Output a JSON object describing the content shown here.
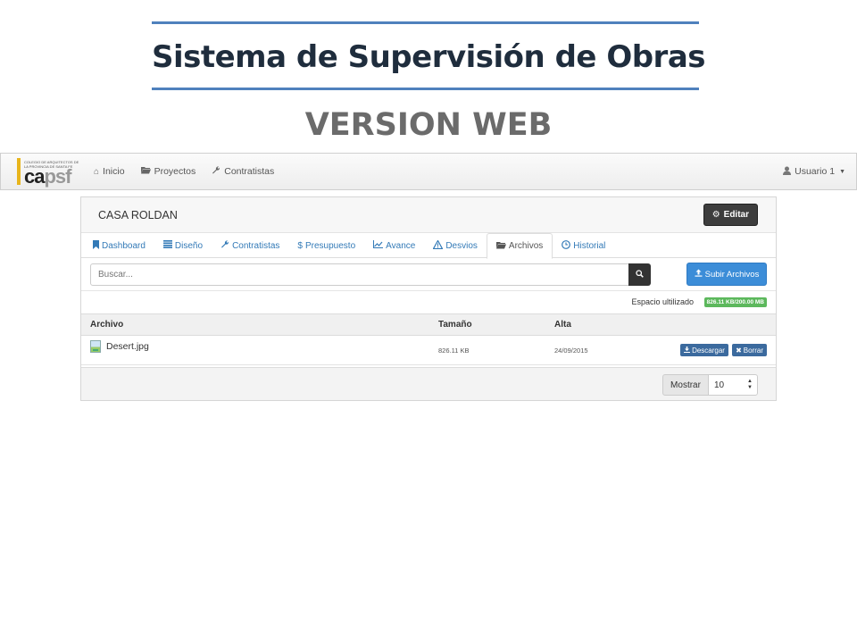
{
  "slide": {
    "title": "Sistema de Supervisión de Obras",
    "subtitle": "VERSION WEB"
  },
  "navbar": {
    "logo_small_text": "COLEGIO DE ARQUITECTOS DE LA PROVINCIA DE SANTA FE",
    "logo_word_a": "ca",
    "logo_word_b": "psf",
    "items": [
      {
        "label": "Inicio",
        "icon": "home-icon"
      },
      {
        "label": "Proyectos",
        "icon": "folder-open-icon"
      },
      {
        "label": "Contratistas",
        "icon": "wrench-icon"
      }
    ],
    "user_label": "Usuario 1"
  },
  "panel": {
    "project_title": "CASA ROLDAN",
    "edit_label": "Editar",
    "tabs": [
      {
        "label": "Dashboard",
        "icon": "bookmark-icon",
        "active": false
      },
      {
        "label": "Diseño",
        "icon": "list-icon",
        "active": false
      },
      {
        "label": "Contratistas",
        "icon": "wrench-icon",
        "active": false
      },
      {
        "label": "Presupuesto",
        "icon": "dollar-icon",
        "active": false
      },
      {
        "label": "Avance",
        "icon": "line-chart-icon",
        "active": false
      },
      {
        "label": "Desvios",
        "icon": "warning-icon",
        "active": false
      },
      {
        "label": "Archivos",
        "icon": "folder-open-icon",
        "active": true
      },
      {
        "label": "Historial",
        "icon": "clock-icon",
        "active": false
      }
    ],
    "search_placeholder": "Buscar...",
    "upload_label": "Subir Archivos",
    "storage_label": "Espacio ultilizado",
    "storage_value": "826.11 KB/200.00 MB",
    "table": {
      "headers": [
        "Archivo",
        "Tamaño",
        "Alta"
      ],
      "rows": [
        {
          "name": "Desert.jpg",
          "size": "826.11 KB",
          "date": "24/09/2015"
        }
      ],
      "download_label": "Descargar",
      "delete_label": "Borrar"
    },
    "show_label": "Mostrar",
    "page_size": "10"
  }
}
